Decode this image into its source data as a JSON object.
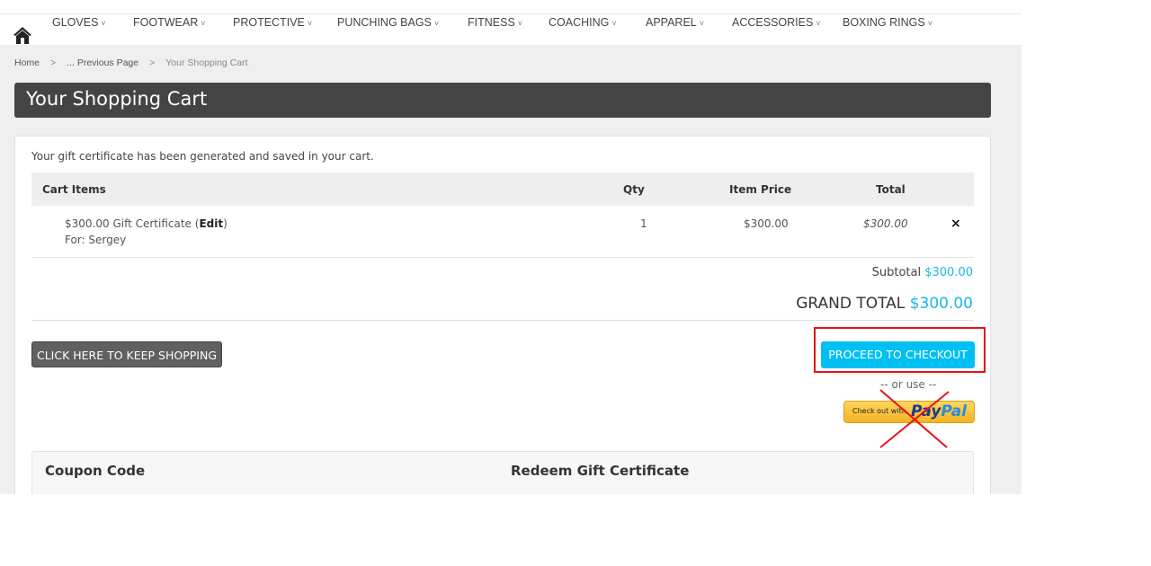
{
  "nav": {
    "items": [
      {
        "label": "GLOVES"
      },
      {
        "label": "FOOTWEAR"
      },
      {
        "label": "PROTECTIVE"
      },
      {
        "label": "PUNCHING BAGS"
      },
      {
        "label": "FITNESS"
      },
      {
        "label": "COACHING"
      },
      {
        "label": "APPAREL"
      },
      {
        "label": "ACCESSORIES"
      },
      {
        "label": "BOXING RINGS"
      }
    ],
    "home_icon": "home-icon",
    "chevron": "˅"
  },
  "breadcrumb": {
    "home": "Home",
    "previous": "... Previous Page",
    "current": "Your Shopping Cart",
    "separator": ">"
  },
  "page_title": "Your Shopping Cart",
  "message": "Your gift certificate has been generated and saved in your cart.",
  "table": {
    "headers": {
      "items": "Cart Items",
      "qty": "Qty",
      "price": "Item Price",
      "total": "Total"
    },
    "rows": [
      {
        "name": "$300.00 Gift Certificate (",
        "edit": "Edit",
        ")": ")",
        "close": ")",
        "for": "For: Sergey",
        "qty": "1",
        "price": "$300.00",
        "total": "$300.00",
        "remove": "×"
      }
    ]
  },
  "summary": {
    "subtotal_label": "Subtotal",
    "subtotal": "$300.00",
    "grand_label": "GRAND TOTAL",
    "grand": "$300.00"
  },
  "buttons": {
    "keep_shopping": "CLICK HERE TO KEEP SHOPPING",
    "checkout": "PROCEED TO CHECKOUT",
    "or_use": "-- or use --",
    "paypal_prefix": "Check out with",
    "paypal_brand_a": "Pay",
    "paypal_brand_b": "Pal"
  },
  "sections": {
    "coupon": "Coupon Code",
    "gift": "Redeem Gift Certificate"
  },
  "colors": {
    "accent": "#00bff3",
    "annotation": "#e3141a",
    "title_bar": "#444444"
  }
}
